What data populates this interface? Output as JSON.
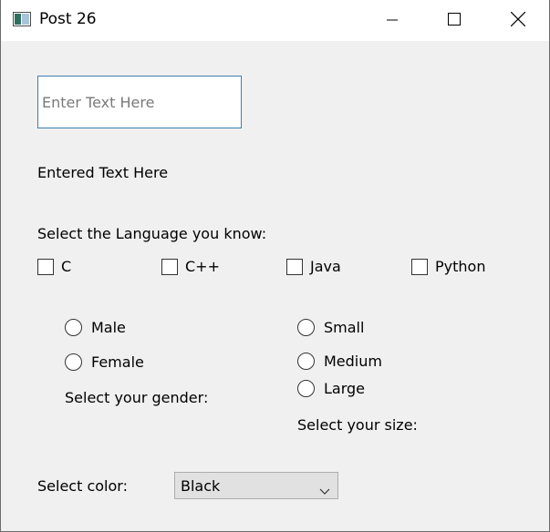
{
  "window": {
    "title": "Post 26",
    "minimize_icon": "minimize-icon",
    "maximize_icon": "maximize-icon",
    "close_icon": "close-icon"
  },
  "text_entry": {
    "placeholder": "Enter Text Here",
    "value": ""
  },
  "entered_text_label": "Entered Text Here",
  "languages": {
    "prompt": "Select the Language you know:",
    "options": [
      {
        "label": "C",
        "checked": false
      },
      {
        "label": "C++",
        "checked": false
      },
      {
        "label": "Java",
        "checked": false
      },
      {
        "label": "Python",
        "checked": false
      }
    ]
  },
  "gender": {
    "options": [
      {
        "label": "Male",
        "selected": false
      },
      {
        "label": "Female",
        "selected": false
      }
    ],
    "prompt": "Select your gender:"
  },
  "size": {
    "options": [
      {
        "label": "Small",
        "selected": false
      },
      {
        "label": "Medium",
        "selected": false
      },
      {
        "label": "Large",
        "selected": false
      }
    ],
    "prompt": "Select your size:"
  },
  "color": {
    "prompt": "Select color:",
    "selected": "Black"
  },
  "colors": {
    "input_border": "#3c7fb1",
    "window_bg": "#f0f0f0",
    "titlebar_bg": "#ffffff"
  }
}
